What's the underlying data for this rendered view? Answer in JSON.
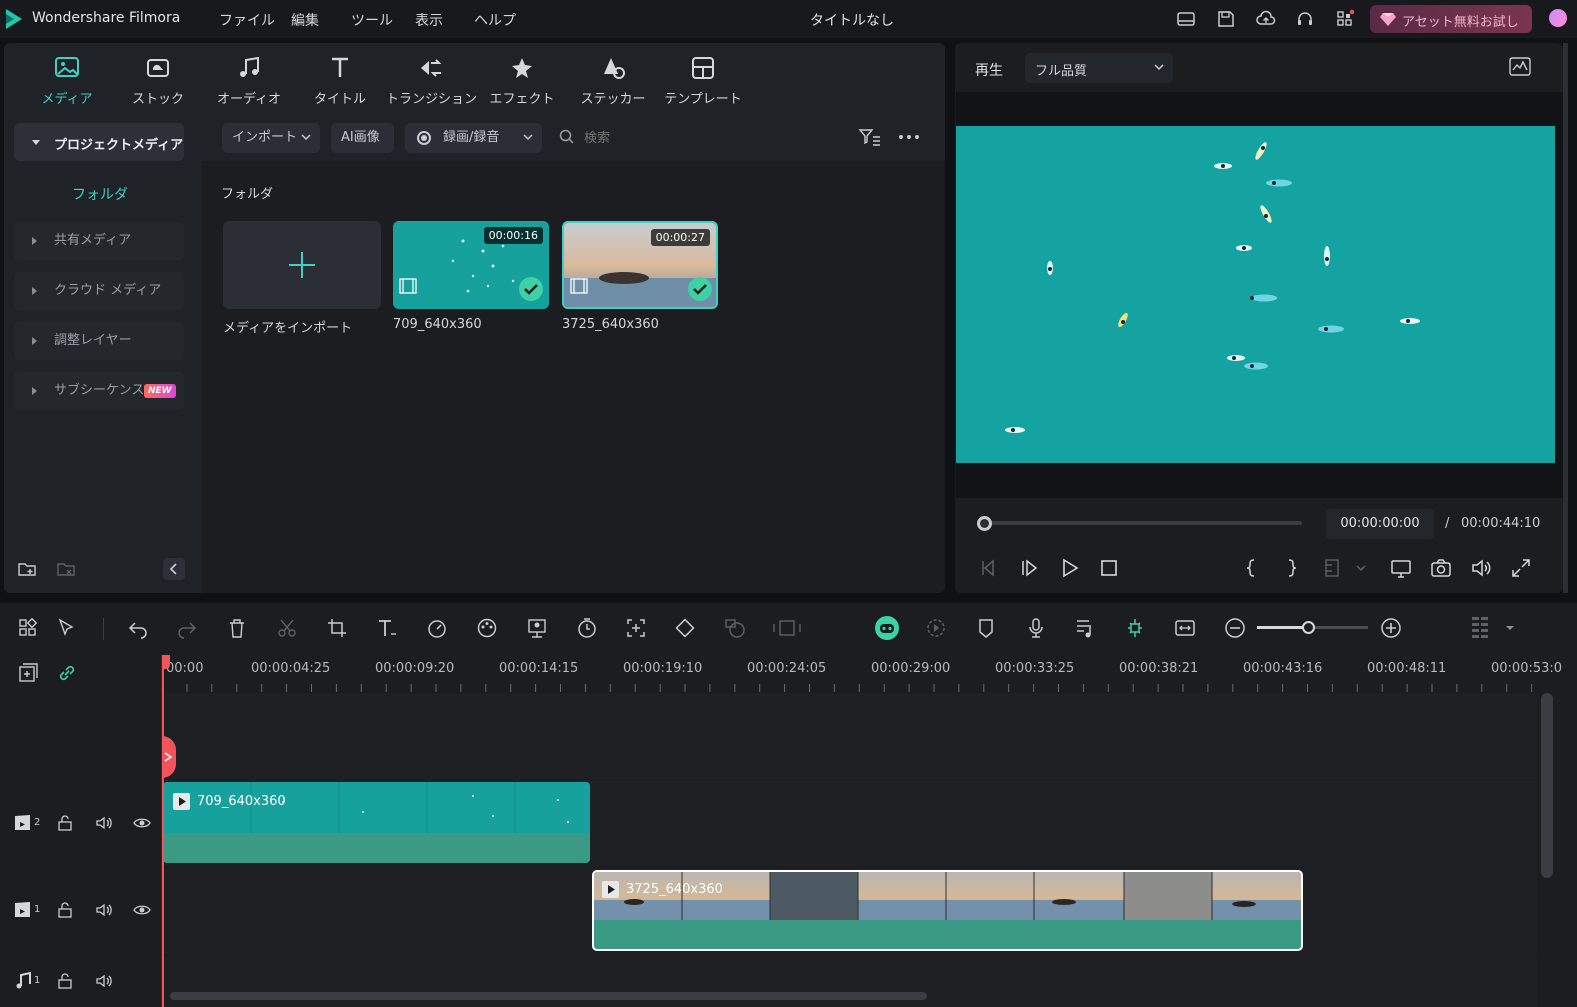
{
  "app": {
    "name": "Wondershare Filmora",
    "doc_title": "タイトルなし",
    "promo_label": "アセット無料お試し"
  },
  "menu": [
    "ファイル",
    "編集",
    "ツール",
    "表示",
    "ヘルプ"
  ],
  "categories": [
    {
      "label": "メディア",
      "icon": "media-icon",
      "active": true
    },
    {
      "label": "ストック",
      "icon": "stock-icon"
    },
    {
      "label": "オーディオ",
      "icon": "music-note-icon"
    },
    {
      "label": "タイトル",
      "icon": "title-t-icon"
    },
    {
      "label": "トランジション",
      "icon": "transition-icon"
    },
    {
      "label": "エフェクト",
      "icon": "effect-star-icon"
    },
    {
      "label": "ステッカー",
      "icon": "sticker-icon"
    },
    {
      "label": "テンプレート",
      "icon": "template-icon"
    }
  ],
  "sidebar": {
    "project_media": "プロジェクトメディア",
    "folder": "フォルダ",
    "items": [
      {
        "label": "共有メディア"
      },
      {
        "label": "クラウド メディア"
      },
      {
        "label": "調整レイヤー"
      },
      {
        "label": "サブシーケンス",
        "badge": "NEW"
      }
    ]
  },
  "media_toolbar": {
    "import": "インポート",
    "ai_image": "AI画像",
    "record": "録画/録音",
    "search_placeholder": "検索"
  },
  "media": {
    "folder_label": "フォルダ",
    "import_label": "メディアをインポート",
    "clips": [
      {
        "name": "709_640x360",
        "duration": "00:00:16"
      },
      {
        "name": "3725_640x360",
        "duration": "00:00:27"
      }
    ]
  },
  "player": {
    "tab": "再生",
    "quality": "フル品質",
    "current_time": "00:00:00:00",
    "separator": "/",
    "total_time": "00:00:44:10",
    "progress": 0
  },
  "ruler": [
    "00:00",
    "00:00:04:25",
    "00:00:09:20",
    "00:00:14:15",
    "00:00:19:10",
    "00:00:24:05",
    "00:00:29:00",
    "00:00:33:25",
    "00:00:38:21",
    "00:00:43:16",
    "00:00:48:11",
    "00:00:53:0"
  ],
  "tracks": {
    "video2": {
      "num": "2",
      "clip": "709_640x360"
    },
    "video1": {
      "num": "1",
      "clip": "3725_640x360"
    },
    "audio1": {
      "num": "1"
    }
  },
  "colors": {
    "accent": "#3fd1a6",
    "playhead": "#f2545b",
    "clip_green": "#3a9a84",
    "ocean": "#14a3a0"
  }
}
